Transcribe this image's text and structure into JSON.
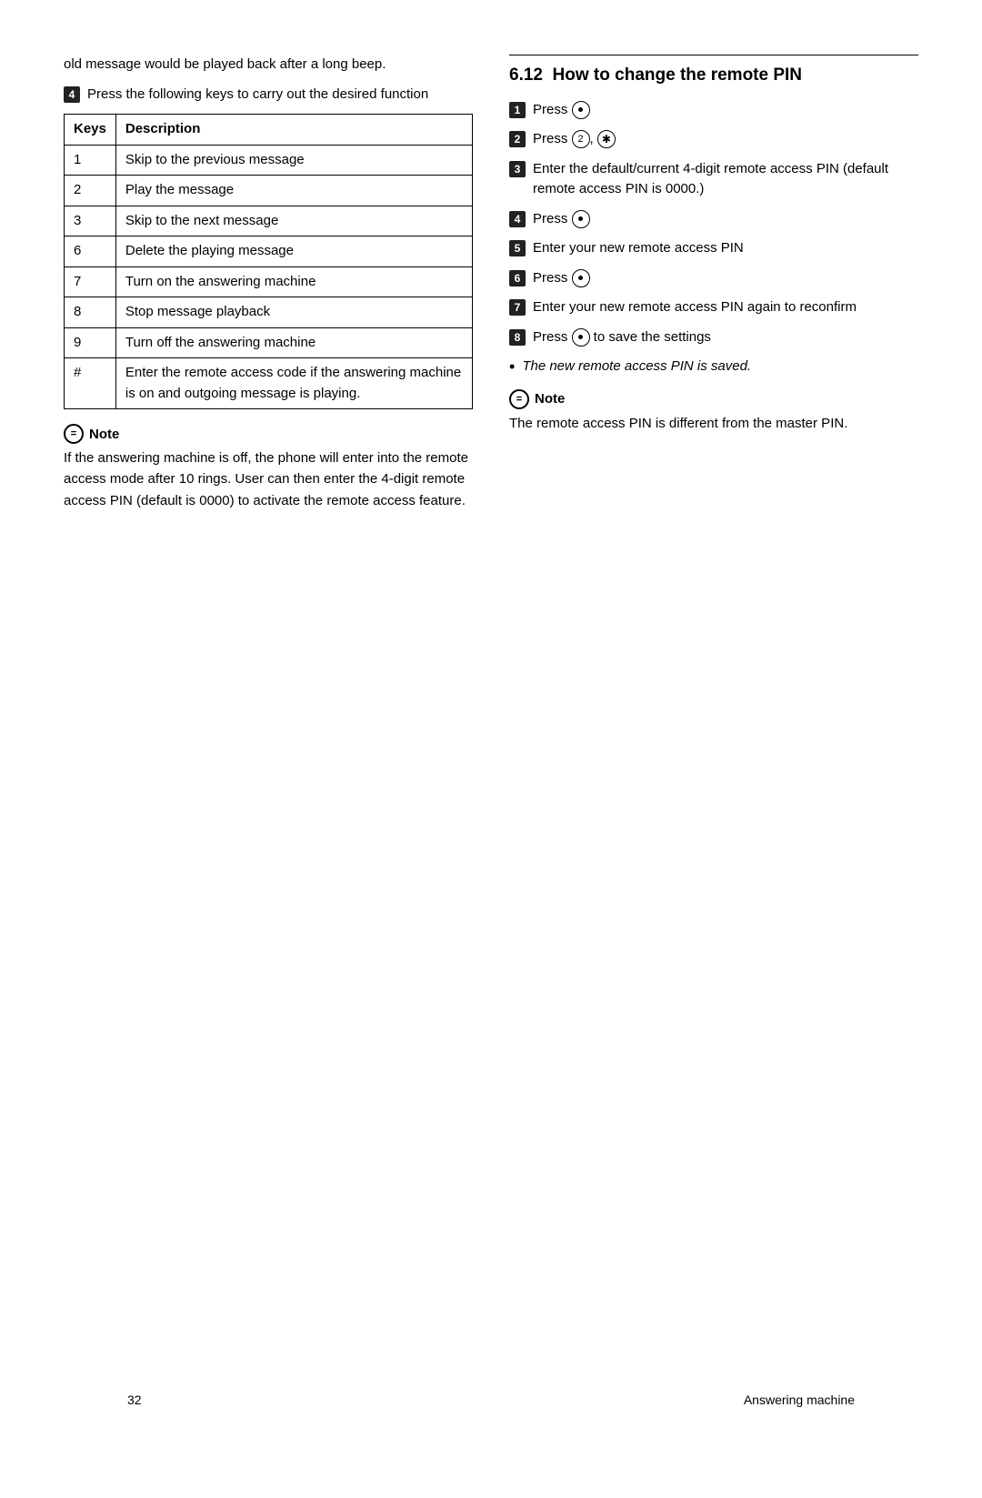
{
  "left": {
    "intro_text": "old message would be played back after a long beep.",
    "step4_label": "4",
    "step4_text": "Press the following keys to carry out the desired function",
    "table": {
      "col1": "Keys",
      "col2": "Description",
      "rows": [
        {
          "key": "1",
          "desc": "Skip to the previous message"
        },
        {
          "key": "2",
          "desc": "Play the message"
        },
        {
          "key": "3",
          "desc": "Skip to the next message"
        },
        {
          "key": "6",
          "desc": "Delete the playing message"
        },
        {
          "key": "7",
          "desc": "Turn on the answering machine"
        },
        {
          "key": "8",
          "desc": "Stop message playback"
        },
        {
          "key": "9",
          "desc": "Turn off the answering machine"
        },
        {
          "key": "#",
          "desc": "Enter the remote access code if the answering machine is on and outgoing message is playing."
        }
      ]
    },
    "note_title": "Note",
    "note_text": "If the answering machine is off, the phone will enter into the remote access mode after 10 rings. User can then enter the 4-digit remote access PIN (default is 0000) to activate the remote access feature."
  },
  "right": {
    "section_num": "6.12",
    "section_title": "How to change the remote PIN",
    "steps": [
      {
        "num": "1",
        "text": "Press "
      },
      {
        "num": "2",
        "text": "Press "
      },
      {
        "num": "3",
        "text": "Enter the default/current 4-digit remote access PIN (default remote access PIN is 0000.)"
      },
      {
        "num": "4",
        "text": "Press "
      },
      {
        "num": "5",
        "text": "Enter your new remote access PIN"
      },
      {
        "num": "6",
        "text": "Press "
      },
      {
        "num": "7",
        "text": "Enter your new remote access PIN again to reconfirm"
      },
      {
        "num": "8",
        "text_prefix": "Press ",
        "text_suffix": " to save the settings"
      }
    ],
    "bullet_italic": "The new remote access PIN is saved.",
    "note_title": "Note",
    "note_text": "The remote access PIN is different from the master PIN."
  },
  "footer": {
    "page_number": "32",
    "section_label": "Answering machine"
  }
}
